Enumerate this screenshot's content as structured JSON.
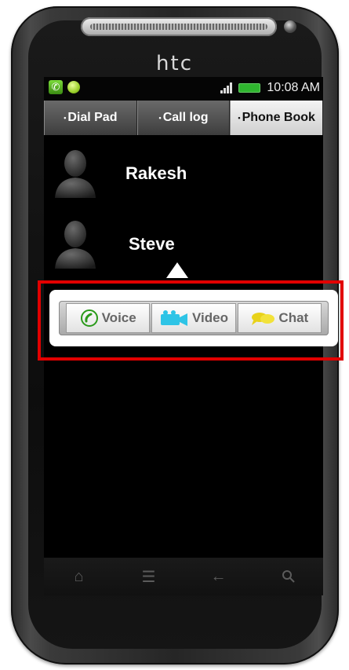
{
  "device": {
    "brand": "htc"
  },
  "statusbar": {
    "time": "10:08 AM"
  },
  "tabs": [
    {
      "label": "Dial Pad",
      "active": false
    },
    {
      "label": "Call log",
      "active": false
    },
    {
      "label": "Phone Book",
      "active": true
    }
  ],
  "contacts": [
    {
      "name": "Rakesh"
    },
    {
      "name": "Steve"
    }
  ],
  "actions": [
    {
      "label": "Voice",
      "icon": "phone-icon",
      "color": "#2a9a1a"
    },
    {
      "label": "Video",
      "icon": "video-camera-icon",
      "color": "#2ec4e6"
    },
    {
      "label": "Chat",
      "icon": "chat-bubble-icon",
      "color": "#e8d21a"
    }
  ],
  "highlight_color": "#e20000"
}
